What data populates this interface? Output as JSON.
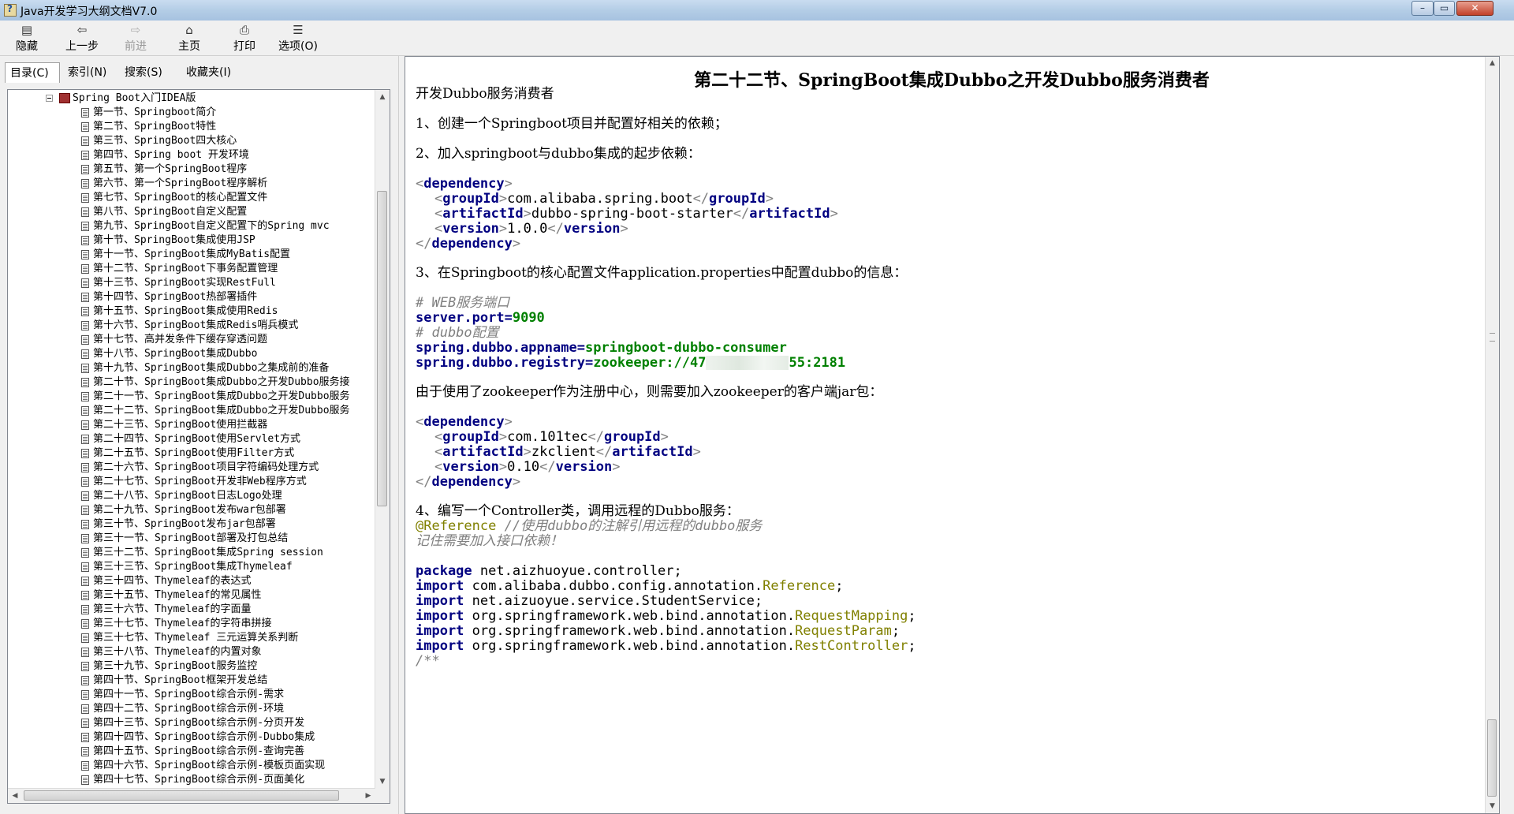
{
  "window": {
    "title": "Java开发学习大纲文档V7.0",
    "controls": {
      "minimize": "–",
      "maximize": "▭",
      "close": "✕"
    }
  },
  "toolbar": {
    "buttons": [
      {
        "label": "隐藏",
        "icon": "hide-icon",
        "glyph": "▤",
        "enabled": true
      },
      {
        "label": "上一步",
        "icon": "back-arrow-icon",
        "glyph": "⇦",
        "enabled": true
      },
      {
        "label": "前进",
        "icon": "forward-arrow-icon",
        "glyph": "⇨",
        "enabled": false
      },
      {
        "label": "主页",
        "icon": "home-icon",
        "glyph": "⌂",
        "enabled": true
      },
      {
        "label": "打印",
        "icon": "print-icon",
        "glyph": "⎙",
        "enabled": true
      },
      {
        "label": "选项(O)",
        "icon": "options-icon",
        "glyph": "☰",
        "enabled": true
      }
    ]
  },
  "nav_tabs": [
    {
      "label": "目录(C)",
      "active": true
    },
    {
      "label": "索引(N)",
      "active": false
    },
    {
      "label": "搜索(S)",
      "active": false
    },
    {
      "label": "收藏夹(I)",
      "active": false
    }
  ],
  "tree": {
    "root": "Spring Boot入门IDEA版",
    "items": [
      "第一节、Springboot简介",
      "第二节、SpringBoot特性",
      "第三节、SpringBoot四大核心",
      "第四节、Spring boot 开发环境",
      "第五节、第一个SpringBoot程序",
      "第六节、第一个SpringBoot程序解析",
      "第七节、SpringBoot的核心配置文件",
      "第八节、SpringBoot自定义配置",
      "第九节、SpringBoot自定义配置下的Spring mvc",
      "第十节、SpringBoot集成使用JSP",
      "第十一节、SpringBoot集成MyBatis配置",
      "第十二节、SpringBoot下事务配置管理",
      "第十三节、SpringBoot实现RestFull",
      "第十四节、SpringBoot热部署插件",
      "第十五节、SpringBoot集成使用Redis",
      "第十六节、SpringBoot集成Redis哨兵模式",
      "第十七节、高并发条件下缓存穿透问题",
      "第十八节、SpringBoot集成Dubbo",
      "第十九节、SpringBoot集成Dubbo之集成前的准备",
      "第二十节、SpringBoot集成Dubbo之开发Dubbo服务接",
      "第二十一节、SpringBoot集成Dubbo之开发Dubbo服务",
      "第二十二节、SpringBoot集成Dubbo之开发Dubbo服务",
      "第二十三节、SpringBoot使用拦截器",
      "第二十四节、SpringBoot使用Servlet方式",
      "第二十五节、SpringBoot使用Filter方式",
      "第二十六节、SpringBoot项目字符编码处理方式",
      "第二十七节、SpringBoot开发非Web程序方式",
      "第二十八节、SpringBoot日志Logo处理",
      "第二十九节、SpringBoot发布war包部署",
      "第三十节、SpringBoot发布jar包部署",
      "第三十一节、SpringBoot部署及打包总结",
      "第三十二节、SpringBoot集成Spring session",
      "第三十三节、SpringBoot集成Thymeleaf",
      "第三十四节、Thymeleaf的表达式",
      "第三十五节、Thymeleaf的常见属性",
      "第三十六节、Thymeleaf的字面量",
      "第三十七节、Thymeleaf的字符串拼接",
      "第三十七节、Thymeleaf 三元运算关系判断",
      "第三十八节、Thymeleaf的内置对象",
      "第三十九节、SpringBoot服务监控",
      "第四十节、SpringBoot框架开发总结",
      "第四十一节、SpringBoot综合示例-需求",
      "第四十二节、SpringBoot综合示例-环境",
      "第四十三节、SpringBoot综合示例-分页开发",
      "第四十四节、SpringBoot综合示例-Dubbo集成",
      "第四十五节、SpringBoot综合示例-查询完善",
      "第四十六节、SpringBoot综合示例-模板页面实现",
      "第四十七节、SpringBoot综合示例-页面美化"
    ]
  },
  "document": {
    "heading": "第二十二节、SpringBoot集成Dubbo之开发Dubbo服务消费者",
    "intro": "开发Dubbo服务消费者",
    "step1": "1、创建一个Springboot项目并配置好相关的依赖；",
    "step2": "2、加入springboot与dubbo集成的起步依赖：",
    "dep1": {
      "dependency_tag": "dependency",
      "group_tag": "groupId",
      "group_val": "com.alibaba.spring.boot",
      "artifact_tag": "artifactId",
      "artifact_val": "dubbo-spring-boot-starter",
      "version_tag": "version",
      "version_val": "1.0.0"
    },
    "step3": "3、在Springboot的核心配置文件application.properties中配置dubbo的信息：",
    "props": {
      "c1": "# WEB服务端口",
      "k1": "server.port",
      "v1": "9090",
      "c2": "# dubbo配置",
      "k2": "spring.dubbo.appname",
      "v2": "springboot-dubbo-consumer",
      "k3": "spring.dubbo.registry",
      "v3a": "zookeeper://47",
      "v3b": "55:2181"
    },
    "zk_note": "由于使用了zookeeper作为注册中心，则需要加入zookeeper的客户端jar包：",
    "dep2": {
      "dependency_tag": "dependency",
      "group_tag": "groupId",
      "group_val": "com.101tec",
      "artifact_tag": "artifactId",
      "artifact_val": "zkclient",
      "version_tag": "version",
      "version_val": "0.10"
    },
    "step4": "4、编写一个Controller类，调用远程的Dubbo服务：",
    "ref_ann": "@Reference",
    "ref_comment": " //使用dubbo的注解引用远程的dubbo服务",
    "remember": "记住需要加入接口依赖！",
    "code": {
      "pkg_kw": "package",
      "pkg": " net.aizhuoyue.controller;",
      "imports": [
        {
          "kw": "import",
          "path": " com.alibaba.dubbo.config.annotation.",
          "cls": "Reference",
          "end": ";"
        },
        {
          "kw": "import",
          "path": " net.aizuoyue.service.StudentService;",
          "cls": "",
          "end": ""
        },
        {
          "kw": "import",
          "path": " org.springframework.web.bind.annotation.",
          "cls": "RequestMapping",
          "end": ";"
        },
        {
          "kw": "import",
          "path": " org.springframework.web.bind.annotation.",
          "cls": "RequestParam",
          "end": ";"
        },
        {
          "kw": "import",
          "path": " org.springframework.web.bind.annotation.",
          "cls": "RestController",
          "end": ";"
        }
      ],
      "doc_start": "/**"
    }
  },
  "colors": {
    "xml_tag": "#000080",
    "xml_bracket": "#808080",
    "comment": "#808080",
    "prop_value": "#008000",
    "annotation": "#808000"
  }
}
